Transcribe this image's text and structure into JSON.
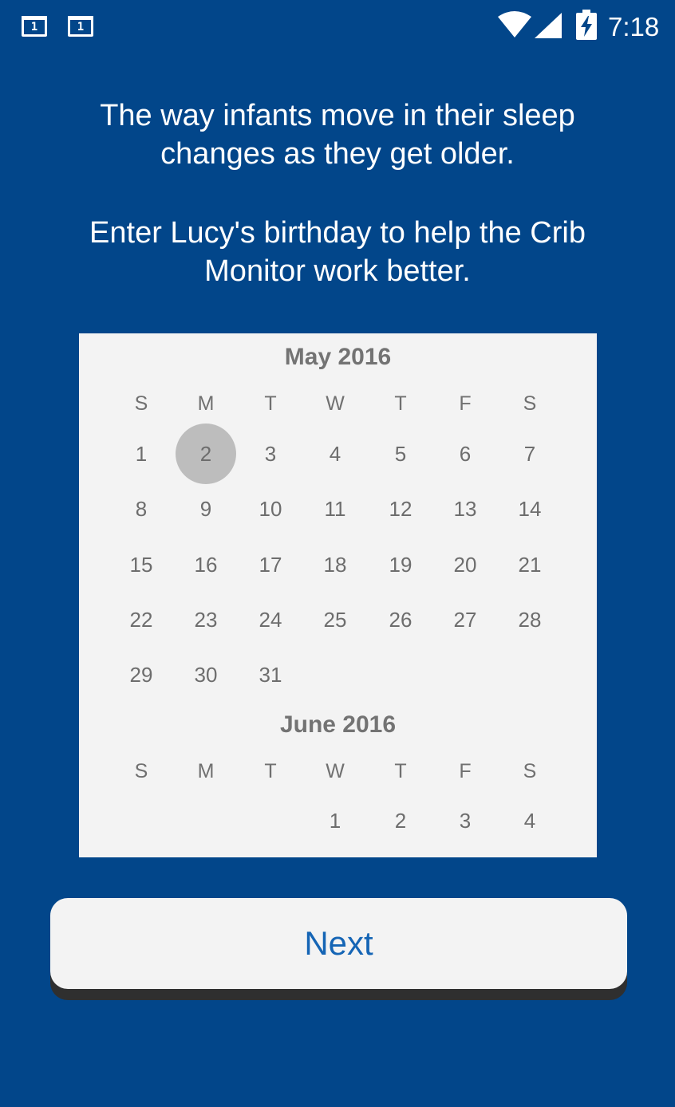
{
  "status_bar": {
    "notification_icons": [
      "1",
      "1"
    ],
    "time": "7:18",
    "icons": [
      "wifi-icon",
      "cell-signal-icon",
      "battery-charging-icon"
    ]
  },
  "intro": {
    "line1": "The way infants move in their sleep changes as they get older.",
    "line2": "Enter Lucy's birthday to help the Crib Monitor work better."
  },
  "calendar": {
    "selected_date": "May 2, 2016",
    "months": [
      {
        "title": "May 2016",
        "weekdays": [
          "S",
          "M",
          "T",
          "W",
          "T",
          "F",
          "S"
        ],
        "weeks": [
          [
            "1",
            "2",
            "3",
            "4",
            "5",
            "6",
            "7"
          ],
          [
            "8",
            "9",
            "10",
            "11",
            "12",
            "13",
            "14"
          ],
          [
            "15",
            "16",
            "17",
            "18",
            "19",
            "20",
            "21"
          ],
          [
            "22",
            "23",
            "24",
            "25",
            "26",
            "27",
            "28"
          ],
          [
            "29",
            "30",
            "31",
            "",
            "",
            "",
            ""
          ]
        ]
      },
      {
        "title": "June 2016",
        "weekdays": [
          "S",
          "M",
          "T",
          "W",
          "T",
          "F",
          "S"
        ],
        "weeks": [
          [
            "",
            "",
            "",
            "1",
            "2",
            "3",
            "4"
          ]
        ]
      }
    ]
  },
  "next_button": {
    "label": "Next"
  },
  "colors": {
    "background": "#02468a",
    "card": "#f3f3f3",
    "selected_day": "#bdbdbd",
    "button_text": "#1565b5"
  }
}
